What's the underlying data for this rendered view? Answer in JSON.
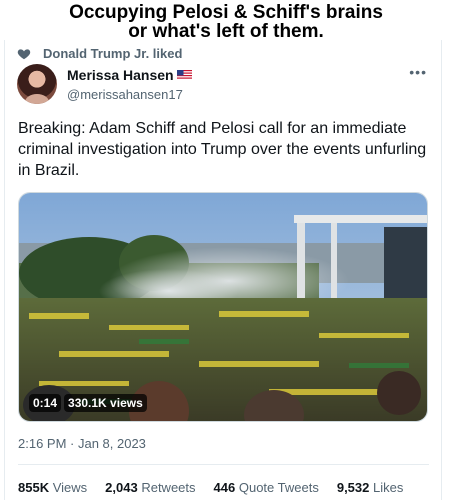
{
  "caption": {
    "line1": "Occupying Pelosi & Schiff's brains",
    "line2": "or what's left of them."
  },
  "tweet": {
    "social_context": "Donald Trump Jr. liked",
    "author": {
      "display_name": "Merissa Hansen",
      "handle": "@merissahansen17"
    },
    "text": "Breaking: Adam Schiff and Pelosi call for an immediate criminal investigation into Trump over the events unfurling in Brazil.",
    "video": {
      "duration": "0:14",
      "views": "330.1K views"
    },
    "timestamp": "2:16 PM · Jan 8, 2023",
    "stats": {
      "views_num": "855K",
      "views_lbl": "Views",
      "retweets_num": "2,043",
      "retweets_lbl": "Retweets",
      "quotes_num": "446",
      "quotes_lbl": "Quote Tweets",
      "likes_num": "9,532",
      "likes_lbl": "Likes"
    }
  },
  "colors": {
    "text_primary": "#0f1419",
    "text_secondary": "#536471",
    "divider": "#e6ecf0"
  }
}
